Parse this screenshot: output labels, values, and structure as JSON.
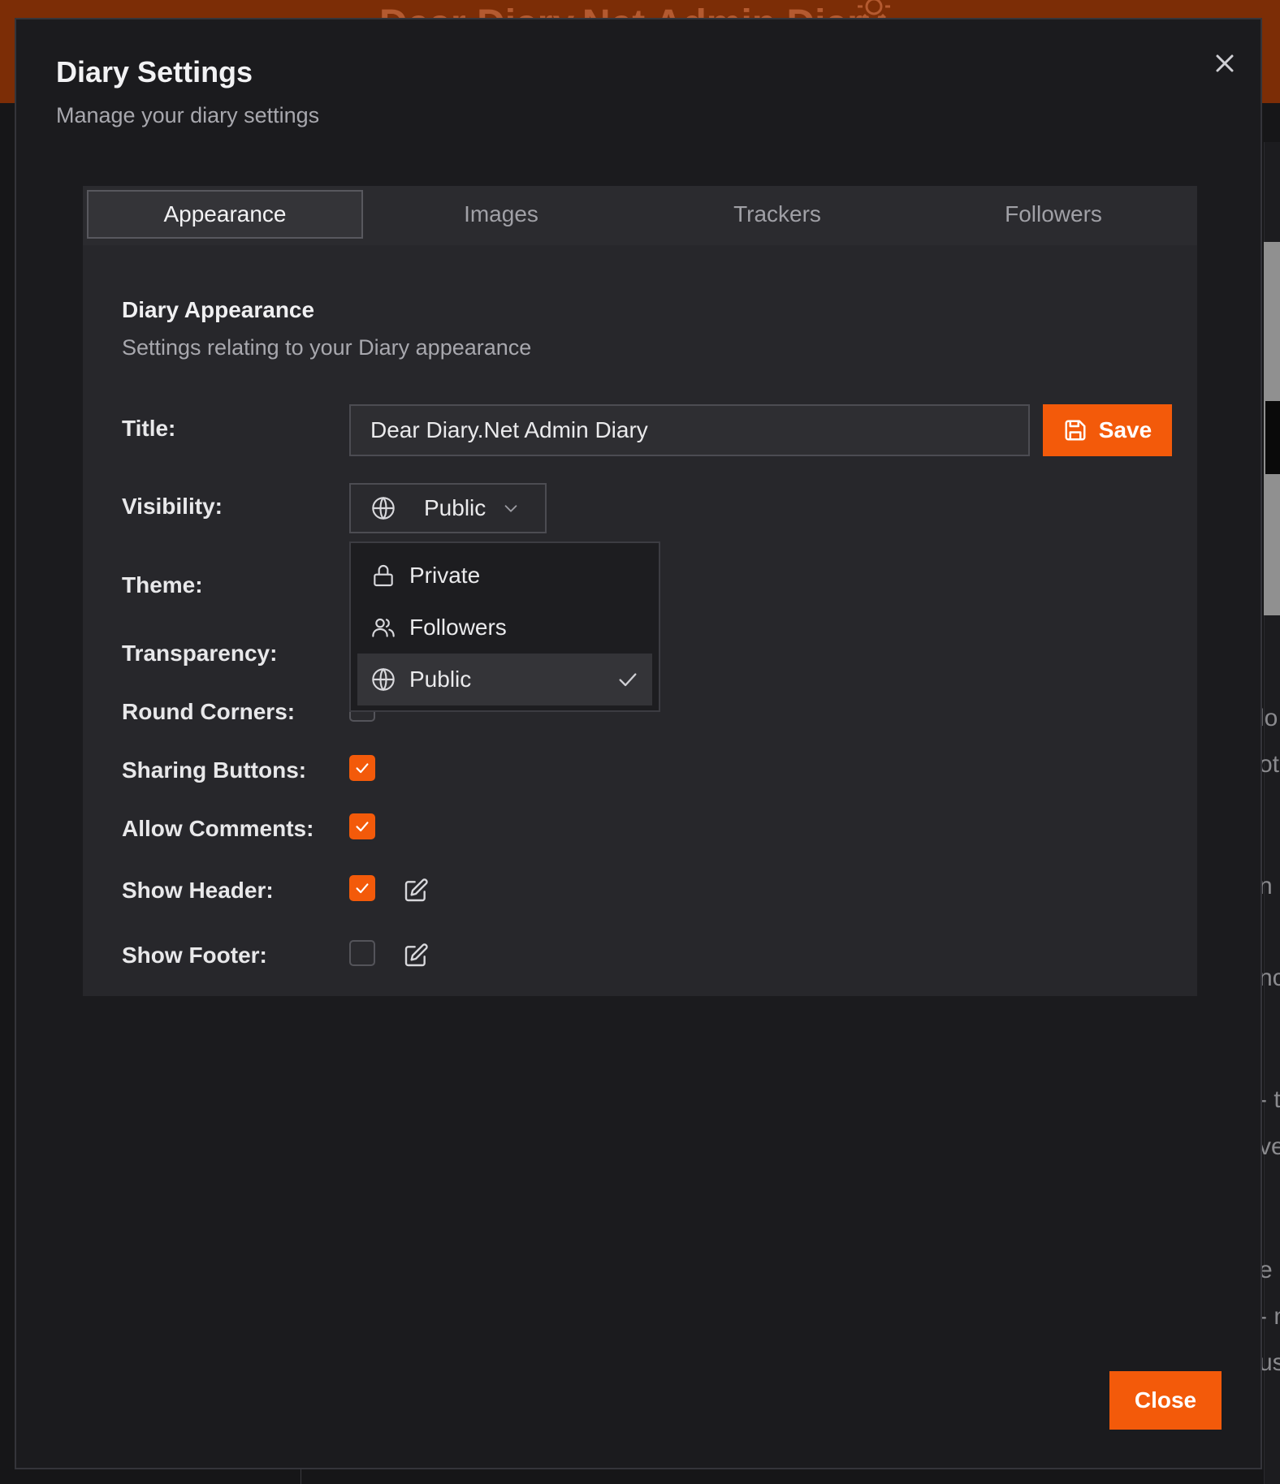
{
  "background": {
    "header_title": "Dear Diary.Net Admin Diary",
    "right_snippets": [
      "lo",
      "ot",
      "n",
      "nc",
      "- t",
      "ve",
      "e",
      "- n",
      "us"
    ]
  },
  "modal": {
    "title": "Diary Settings",
    "subtitle": "Manage your diary settings",
    "close_button": "Close"
  },
  "tabs": [
    {
      "label": "Appearance",
      "active": true
    },
    {
      "label": "Images",
      "active": false
    },
    {
      "label": "Trackers",
      "active": false
    },
    {
      "label": "Followers",
      "active": false
    }
  ],
  "section": {
    "title": "Diary Appearance",
    "subtitle": "Settings relating to your Diary appearance"
  },
  "form": {
    "title_label": "Title:",
    "title_value": "Dear Diary.Net Admin Diary",
    "save_label": "Save",
    "visibility_label": "Visibility:",
    "visibility_value": "Public",
    "theme_label": "Theme:",
    "transparency_label": "Transparency:",
    "round_corners_label": "Round Corners:",
    "sharing_buttons_label": "Sharing Buttons:",
    "sharing_buttons_checked": true,
    "allow_comments_label": "Allow Comments:",
    "allow_comments_checked": true,
    "show_header_label": "Show Header:",
    "show_header_checked": true,
    "show_footer_label": "Show Footer:",
    "show_footer_checked": false
  },
  "visibility_options": [
    {
      "label": "Private",
      "icon": "lock-icon",
      "selected": false
    },
    {
      "label": "Followers",
      "icon": "users-icon",
      "selected": false
    },
    {
      "label": "Public",
      "icon": "globe-icon",
      "selected": true
    }
  ],
  "colors": {
    "accent": "#f35a0a",
    "header_bg": "#7c2d06",
    "modal_bg": "#1b1b1e",
    "card_bg": "#27272b"
  }
}
